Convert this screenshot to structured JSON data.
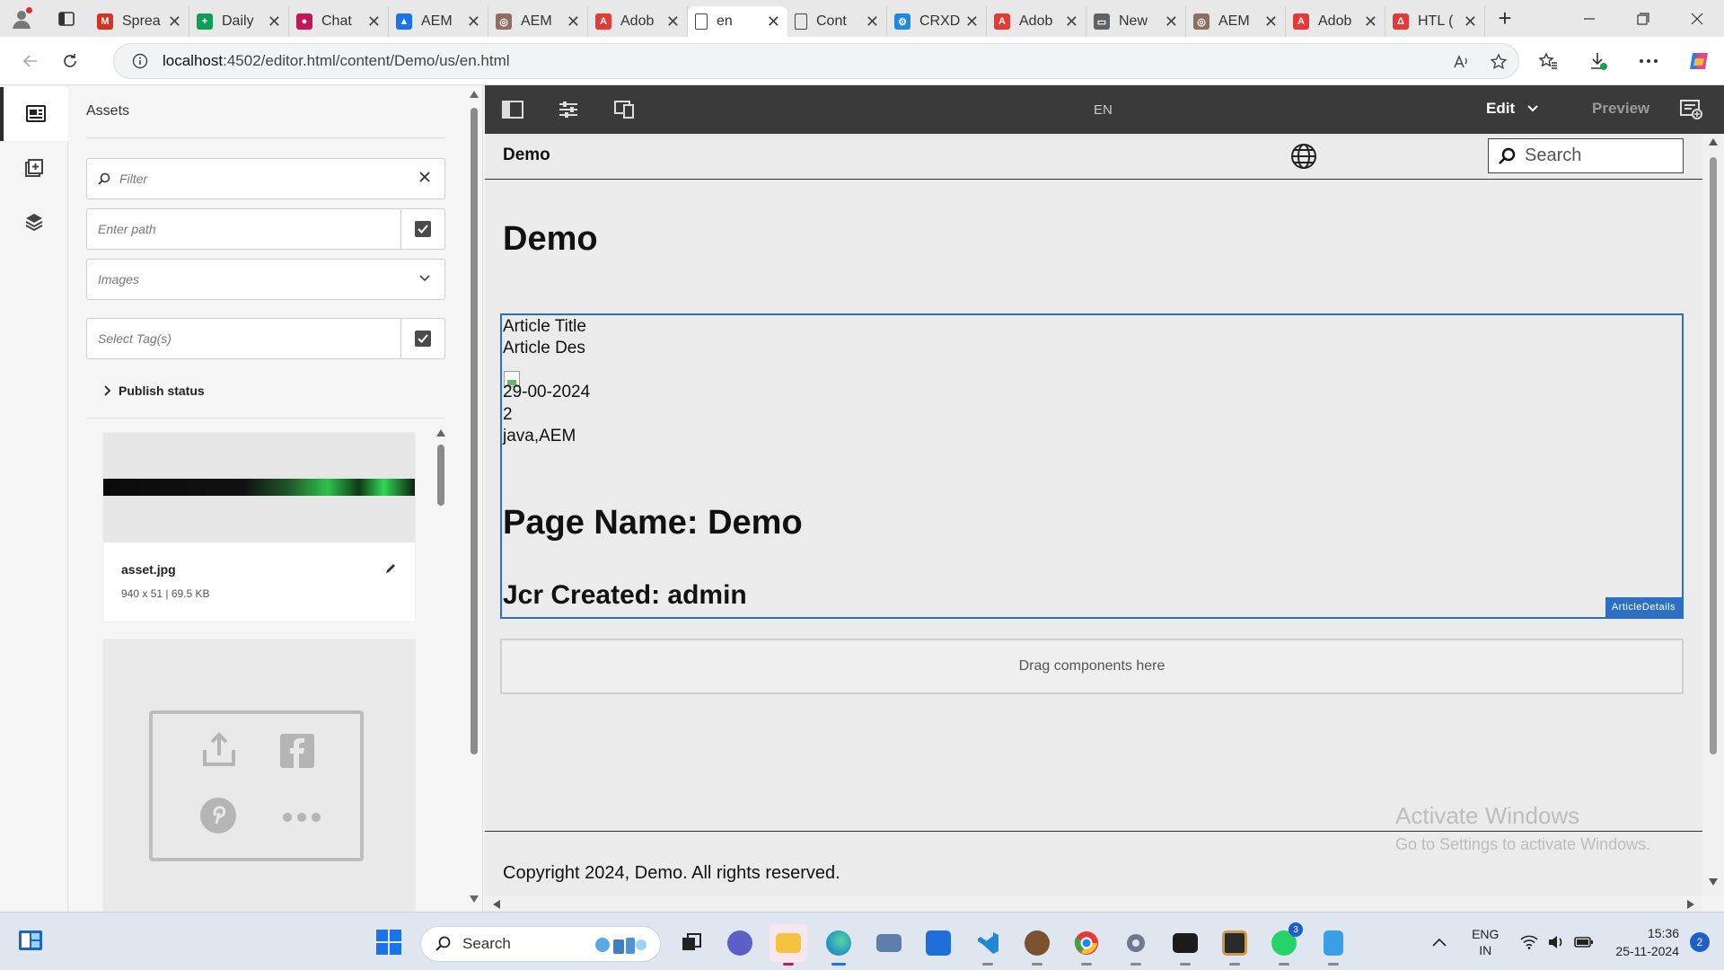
{
  "browser": {
    "tabs": [
      {
        "label": "Sprea",
        "color": "#d93025"
      },
      {
        "label": "Daily",
        "color": "#0f9d58"
      },
      {
        "label": "Chat",
        "color": "#c2185b"
      },
      {
        "label": "AEM",
        "color": "#1a73e8"
      },
      {
        "label": "AEM",
        "color": "#8d6e63"
      },
      {
        "label": "Adob",
        "color": "#e53935"
      },
      {
        "label": "en",
        "color": "#5f6368"
      },
      {
        "label": "Cont",
        "color": "#5f6368"
      },
      {
        "label": "CRXD",
        "color": "#1e88e5"
      },
      {
        "label": "Adob",
        "color": "#e53935"
      },
      {
        "label": "New",
        "color": "#5f6368"
      },
      {
        "label": "AEM",
        "color": "#8d6e63"
      },
      {
        "label": "Adob",
        "color": "#e53935"
      },
      {
        "label": "HTL (",
        "color": "#e53935"
      }
    ],
    "active_tab_index": 6,
    "url_host": "localhost",
    "url_rest": ":4502/editor.html/content/Demo/us/en.html"
  },
  "rail": {
    "items": [
      "assets-icon",
      "components-icon",
      "content-tree-icon"
    ]
  },
  "assets_panel": {
    "title": "Assets",
    "filter_placeholder": "Filter",
    "path_placeholder": "Enter path",
    "type_select": "Images",
    "tags_placeholder": "Select Tag(s)",
    "publish_status": "Publish status",
    "asset": {
      "name": "asset.jpg",
      "meta": "940 x 51 | 69.5 KB"
    }
  },
  "editor": {
    "language": "EN",
    "mode": "Edit",
    "preview": "Preview"
  },
  "page": {
    "brand": "Demo",
    "search_placeholder": "Search",
    "title": "Demo",
    "article": {
      "title": "Article Title",
      "description": "Article Des",
      "date": "29-00-2024",
      "count": "2",
      "tags": "java,AEM",
      "page_name": "Page Name: Demo",
      "jcr_created": "Jcr Created: admin",
      "component_label": "ArticleDetails"
    },
    "dropzone": "Drag components here",
    "footer": "Copyright 2024, Demo. All rights reserved."
  },
  "watermark": {
    "line1": "Activate Windows",
    "line2": "Go to Settings to activate Windows."
  },
  "taskbar": {
    "search": "Search",
    "lang_top": "ENG",
    "lang_bottom": "IN",
    "time": "15:36",
    "date": "25-11-2024",
    "notifications": "2",
    "whatsapp_badge": "3"
  }
}
